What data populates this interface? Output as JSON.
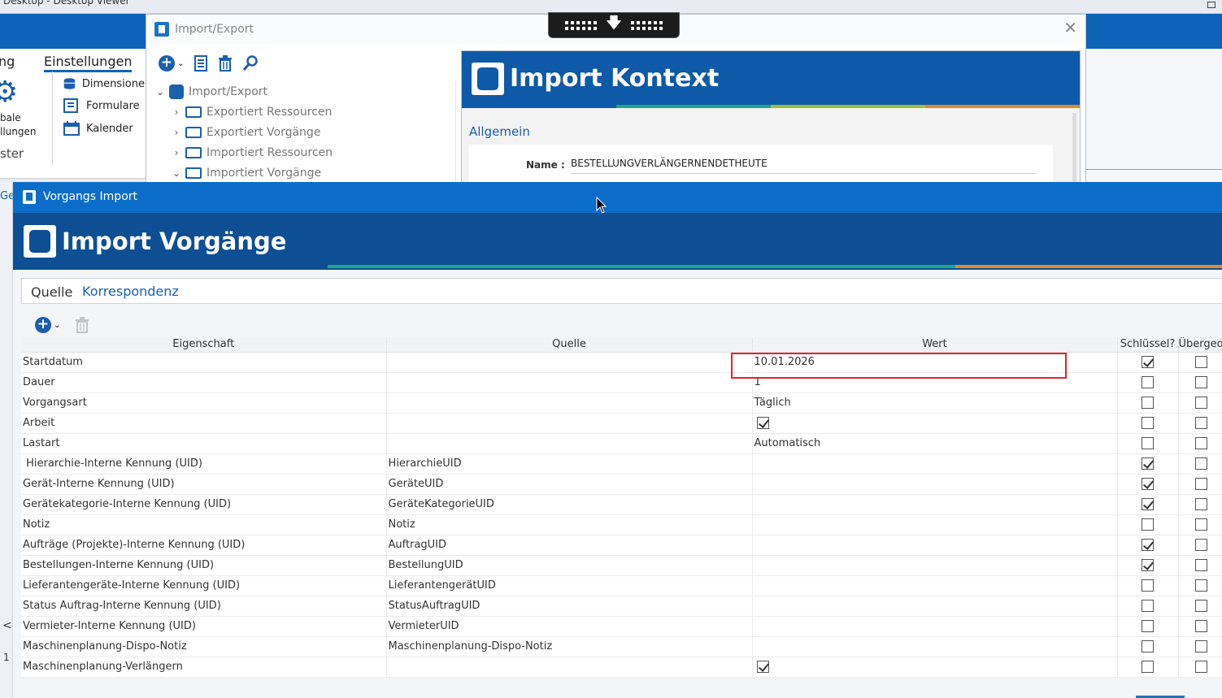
{
  "background_app": {
    "title": "Desktop - Desktop Viewer",
    "ribbon_tab_left": "ng",
    "ribbon_tab_active": "Einstellungen",
    "ribbon_items": [
      "Dimensione",
      "Formulare",
      "Kalender"
    ],
    "left_labels": [
      "bale",
      "llungen",
      "ster"
    ],
    "left_strip_tab": "Ge",
    "left_strip_chevron": "<",
    "left_strip_number": "1"
  },
  "import_export": {
    "title": "Import/Export",
    "close_glyph": "✕",
    "tree": [
      {
        "label": "Import/Export",
        "expanded": true,
        "icon": "database-icon"
      },
      {
        "label": "Exportiert Ressourcen",
        "expanded": false,
        "icon": "folder-icon"
      },
      {
        "label": "Exportiert Vorgänge",
        "expanded": false,
        "icon": "folder-icon"
      },
      {
        "label": "Importiert Ressourcen",
        "expanded": false,
        "icon": "folder-icon"
      },
      {
        "label": "Importiert Vorgänge",
        "expanded": true,
        "icon": "folder-icon"
      }
    ],
    "panel": {
      "title": "Import Kontext",
      "section": "Allgemein",
      "name_label": "Name :",
      "name_value": "BESTELLUNGVERLÄNGERNENDETHEUTE"
    }
  },
  "vorgangs_import": {
    "title": "Vorgangs Import",
    "banner_title": "Import Vorgänge",
    "source_label": "Quelle",
    "source_value": "Korrespondenz",
    "columns": [
      "Eigenschaft",
      "Quelle",
      "Wert",
      "Schlüssel?",
      "Übergeo"
    ],
    "rows": [
      {
        "eigenschaft": "Startdatum",
        "quelle": "",
        "wert": "10.01.2026",
        "wert_checkbox": null,
        "schluessel": true,
        "uebergeordnet": false
      },
      {
        "eigenschaft": "Dauer",
        "quelle": "",
        "wert": "1",
        "wert_checkbox": null,
        "schluessel": false,
        "uebergeordnet": false
      },
      {
        "eigenschaft": "Vorgangsart",
        "quelle": "",
        "wert": "Täglich",
        "wert_checkbox": null,
        "schluessel": false,
        "uebergeordnet": false
      },
      {
        "eigenschaft": "Arbeit",
        "quelle": "",
        "wert": "",
        "wert_checkbox": true,
        "schluessel": false,
        "uebergeordnet": false
      },
      {
        "eigenschaft": "Lastart",
        "quelle": "",
        "wert": "Automatisch",
        "wert_checkbox": null,
        "schluessel": false,
        "uebergeordnet": false
      },
      {
        "eigenschaft": " Hierarchie-Interne Kennung (UID)",
        "quelle": "HierarchieUID",
        "wert": "",
        "wert_checkbox": null,
        "schluessel": true,
        "uebergeordnet": false
      },
      {
        "eigenschaft": "Gerät-Interne Kennung (UID)",
        "quelle": "GeräteUID",
        "wert": "",
        "wert_checkbox": null,
        "schluessel": true,
        "uebergeordnet": false
      },
      {
        "eigenschaft": "Gerätekategorie-Interne Kennung (UID)",
        "quelle": "GeräteKategorieUID",
        "wert": "",
        "wert_checkbox": null,
        "schluessel": true,
        "uebergeordnet": false
      },
      {
        "eigenschaft": "Notiz",
        "quelle": "Notiz",
        "wert": "",
        "wert_checkbox": null,
        "schluessel": false,
        "uebergeordnet": false
      },
      {
        "eigenschaft": "Aufträge (Projekte)-Interne Kennung (UID)",
        "quelle": "AuftragUID",
        "wert": "",
        "wert_checkbox": null,
        "schluessel": true,
        "uebergeordnet": false
      },
      {
        "eigenschaft": "Bestellungen-Interne Kennung (UID)",
        "quelle": "BestellungUID",
        "wert": "",
        "wert_checkbox": null,
        "schluessel": true,
        "uebergeordnet": false
      },
      {
        "eigenschaft": "Lieferantengeräte-Interne Kennung (UID)",
        "quelle": "LieferantengerätUID",
        "wert": "",
        "wert_checkbox": null,
        "schluessel": false,
        "uebergeordnet": false
      },
      {
        "eigenschaft": "Status Auftrag-Interne Kennung (UID)",
        "quelle": "StatusAuftragUID",
        "wert": "",
        "wert_checkbox": null,
        "schluessel": false,
        "uebergeordnet": false
      },
      {
        "eigenschaft": "Vermieter-Interne Kennung (UID)",
        "quelle": "VermieterUID",
        "wert": "",
        "wert_checkbox": null,
        "schluessel": false,
        "uebergeordnet": false
      },
      {
        "eigenschaft": "Maschinenplanung-Dispo-Notiz",
        "quelle": "Maschinenplanung-Dispo-Notiz",
        "wert": "",
        "wert_checkbox": null,
        "schluessel": false,
        "uebergeordnet": false
      },
      {
        "eigenschaft": "Maschinenplanung-Verlängern",
        "quelle": "",
        "wert": "",
        "wert_checkbox": true,
        "schluessel": false,
        "uebergeordnet": false
      }
    ]
  },
  "colors": {
    "accent_blue": "#0e63b8",
    "banner_blue": "#0e4f93",
    "stripe_green": "#1fa58a",
    "stripe_orange": "#e08a2c",
    "highlight_red": "#e0252b"
  }
}
